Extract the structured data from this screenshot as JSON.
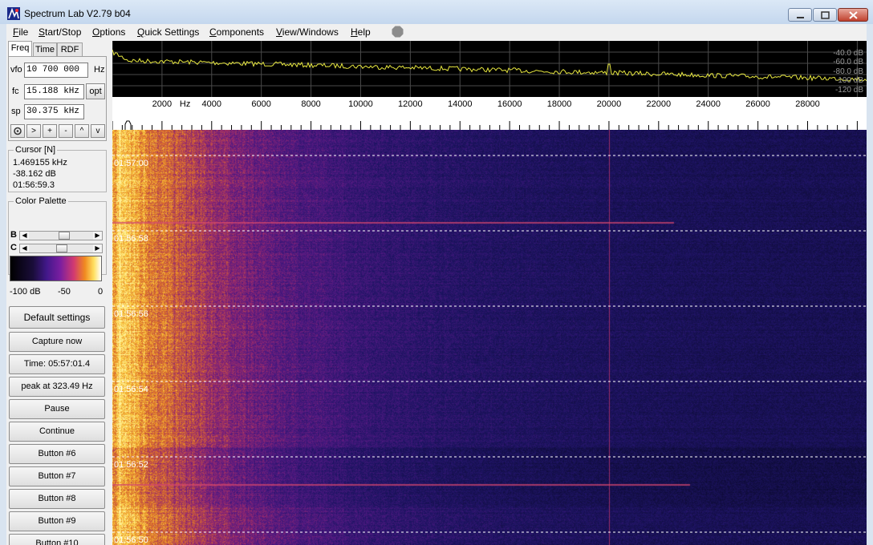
{
  "window": {
    "title": "Spectrum Lab V2.79 b04"
  },
  "menu": [
    {
      "key": "F",
      "rest": "ile"
    },
    {
      "key": "S",
      "rest": "tart/Stop"
    },
    {
      "key": "O",
      "rest": "ptions"
    },
    {
      "key": "Q",
      "rest": "uick Settings"
    },
    {
      "key": "C",
      "rest": "omponents"
    },
    {
      "key": "V",
      "rest": "iew/Windows"
    },
    {
      "key": "H",
      "rest": "elp"
    }
  ],
  "tabs": [
    "Freq",
    "Time",
    "RDF"
  ],
  "freq": {
    "vfo_label": "vfo",
    "vfo_value": "10 700 000",
    "vfo_unit": "Hz",
    "fc_label": "fc",
    "fc_value": "15.188 kHz",
    "opt_label": "opt",
    "sp_label": "sp",
    "sp_value": "30.375 kHz",
    "buttons": [
      ">",
      "+",
      "-",
      "^",
      "v"
    ]
  },
  "cursor": {
    "title": "Cursor [N]",
    "freq": "1.469155 kHz",
    "level": "-38.162 dB",
    "time": "01:56:59.3"
  },
  "palette": {
    "title": "Color Palette",
    "b_label": "B",
    "c_label": "C",
    "b_value": 0.55,
    "c_value": 0.5,
    "min_label": "-100 dB",
    "mid_label": "-50",
    "max_label": "0"
  },
  "buttons": [
    "Default settings",
    "Capture now",
    "Time:  05:57:01.4",
    "peak at 323.49 Hz",
    "Pause",
    "Continue",
    "Button #6",
    "Button #7",
    "Button #8",
    "Button #9",
    "Button #10"
  ],
  "spectrum": {
    "db_labels": [
      "-40.0 dB",
      "-60.0 dB",
      "-80.0 dB",
      "-100 dB",
      "-120 dB"
    ],
    "trace_color": "#e8e840"
  },
  "freq_scale": {
    "unit": "Hz",
    "labels": [
      2000,
      4000,
      6000,
      8000,
      10000,
      12000,
      14000,
      16000,
      18000,
      20000,
      22000,
      24000,
      26000,
      28000
    ],
    "max_hz": 30375
  },
  "waterfall": {
    "time_marks": [
      "01:57:00",
      "01:56:58",
      "01:56:56",
      "01:56:54",
      "01:56:52",
      "01:56:50"
    ],
    "marker_hz": 20000,
    "marker_color": "#c0487a"
  }
}
